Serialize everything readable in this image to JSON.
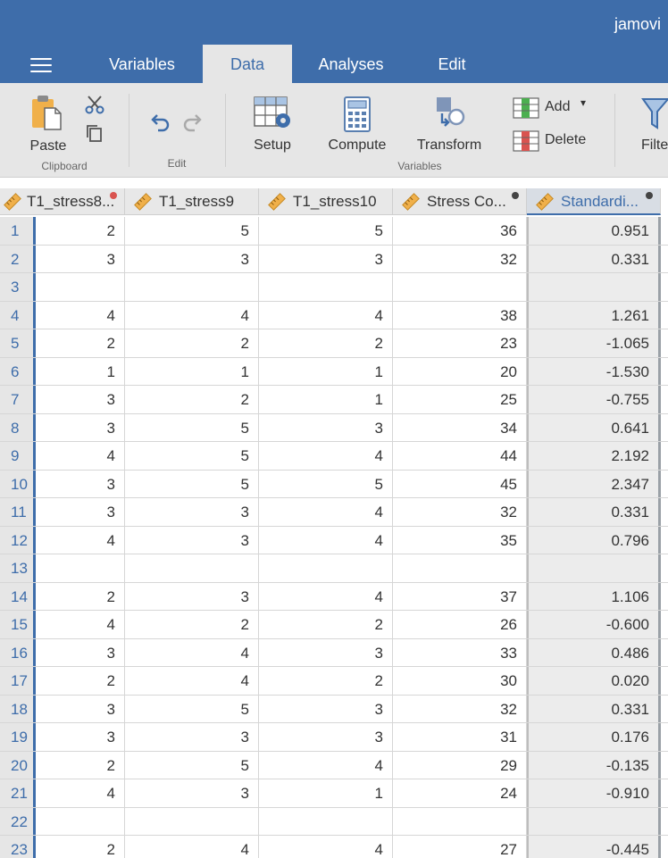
{
  "app": {
    "title": "jamovi"
  },
  "tabs": [
    {
      "label": "Variables"
    },
    {
      "label": "Data"
    },
    {
      "label": "Analyses"
    },
    {
      "label": "Edit"
    }
  ],
  "ribbon": {
    "paste": "Paste",
    "clipboard_group": "Clipboard",
    "edit_group": "Edit",
    "setup": "Setup",
    "compute": "Compute",
    "transform": "Transform",
    "add": "Add",
    "delete": "Delete",
    "variables_group": "Variables",
    "filters": "Filte"
  },
  "columns": [
    {
      "name": "T1_stress8...",
      "dot_color": "#d9534f"
    },
    {
      "name": "T1_stress9"
    },
    {
      "name": "T1_stress10"
    },
    {
      "name": "Stress Co...",
      "dot_color": "#444444"
    },
    {
      "name": "Standardi...",
      "dot_color": "#444444"
    }
  ],
  "rows": [
    {
      "n": "1",
      "v": [
        "2",
        "5",
        "5",
        "36",
        "0.951"
      ]
    },
    {
      "n": "2",
      "v": [
        "3",
        "3",
        "3",
        "32",
        "0.331"
      ]
    },
    {
      "n": "3",
      "v": [
        "",
        "",
        "",
        "",
        ""
      ]
    },
    {
      "n": "4",
      "v": [
        "4",
        "4",
        "4",
        "38",
        "1.261"
      ]
    },
    {
      "n": "5",
      "v": [
        "2",
        "2",
        "2",
        "23",
        "-1.065"
      ]
    },
    {
      "n": "6",
      "v": [
        "1",
        "1",
        "1",
        "20",
        "-1.530"
      ]
    },
    {
      "n": "7",
      "v": [
        "3",
        "2",
        "1",
        "25",
        "-0.755"
      ]
    },
    {
      "n": "8",
      "v": [
        "3",
        "5",
        "3",
        "34",
        "0.641"
      ]
    },
    {
      "n": "9",
      "v": [
        "4",
        "5",
        "4",
        "44",
        "2.192"
      ]
    },
    {
      "n": "10",
      "v": [
        "3",
        "5",
        "5",
        "45",
        "2.347"
      ]
    },
    {
      "n": "11",
      "v": [
        "3",
        "3",
        "4",
        "32",
        "0.331"
      ]
    },
    {
      "n": "12",
      "v": [
        "4",
        "3",
        "4",
        "35",
        "0.796"
      ]
    },
    {
      "n": "13",
      "v": [
        "",
        "",
        "",
        "",
        ""
      ]
    },
    {
      "n": "14",
      "v": [
        "2",
        "3",
        "4",
        "37",
        "1.106"
      ]
    },
    {
      "n": "15",
      "v": [
        "4",
        "2",
        "2",
        "26",
        "-0.600"
      ]
    },
    {
      "n": "16",
      "v": [
        "3",
        "4",
        "3",
        "33",
        "0.486"
      ]
    },
    {
      "n": "17",
      "v": [
        "2",
        "4",
        "2",
        "30",
        "0.020"
      ]
    },
    {
      "n": "18",
      "v": [
        "3",
        "5",
        "3",
        "32",
        "0.331"
      ]
    },
    {
      "n": "19",
      "v": [
        "3",
        "3",
        "3",
        "31",
        "0.176"
      ]
    },
    {
      "n": "20",
      "v": [
        "2",
        "5",
        "4",
        "29",
        "-0.135"
      ]
    },
    {
      "n": "21",
      "v": [
        "4",
        "3",
        "1",
        "24",
        "-0.910"
      ]
    },
    {
      "n": "22",
      "v": [
        "",
        "",
        "",
        "",
        ""
      ]
    },
    {
      "n": "23",
      "v": [
        "2",
        "4",
        "4",
        "27",
        "-0.445"
      ]
    }
  ]
}
